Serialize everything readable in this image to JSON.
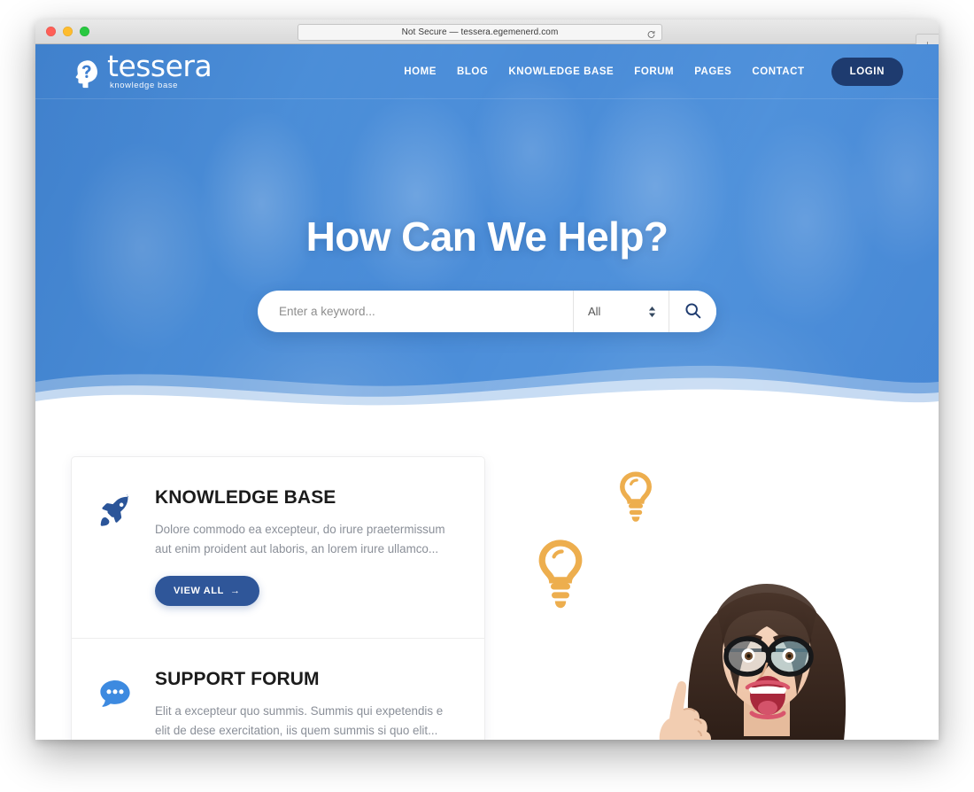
{
  "browser": {
    "url_text": "Not Secure — tessera.egemenerd.com",
    "reload_label": "Reload",
    "new_tab_label": "+"
  },
  "site": {
    "logo_word": "tessera",
    "logo_sub": "knowledge base",
    "logo_icon": "head-question-mark-icon"
  },
  "nav": {
    "items": [
      {
        "label": "HOME"
      },
      {
        "label": "BLOG"
      },
      {
        "label": "KNOWLEDGE BASE"
      },
      {
        "label": "FORUM"
      },
      {
        "label": "PAGES"
      },
      {
        "label": "CONTACT"
      }
    ],
    "login_label": "LOGIN"
  },
  "hero": {
    "title": "How Can We Help?",
    "search": {
      "placeholder": "Enter a keyword...",
      "value": "",
      "category_selected": "All",
      "category_options": [
        "All"
      ],
      "submit_icon": "search-icon"
    }
  },
  "cards": [
    {
      "icon": "rocket-icon",
      "title": "KNOWLEDGE BASE",
      "text": "Dolore commodo ea excepteur, do irure praetermissum aut enim proident aut laboris, an lorem irure ullamco...",
      "button_label": "VIEW ALL",
      "button_arrow": "→"
    },
    {
      "icon": "speech-bubble-icon",
      "title": "SUPPORT FORUM",
      "text": "Elit a excepteur quo summis. Summis qui expetendis e elit de dese exercitation, iis quem summis si quo elit..."
    }
  ],
  "illustration": {
    "bulb_large": "lightbulb-icon",
    "bulb_small": "lightbulb-icon",
    "photo": "excited-woman-pointing-up-photo"
  },
  "colors": {
    "hero_blue": "#4a88d2",
    "nav_login_navy": "#1e3b6f",
    "button_blue": "#2f5699",
    "rocket_blue": "#2b5599",
    "bubble_blue": "#3d8ae0",
    "bulb_orange": "#edae4e",
    "body_text": "#8a8f98",
    "heading_text": "#1b1b1b"
  }
}
